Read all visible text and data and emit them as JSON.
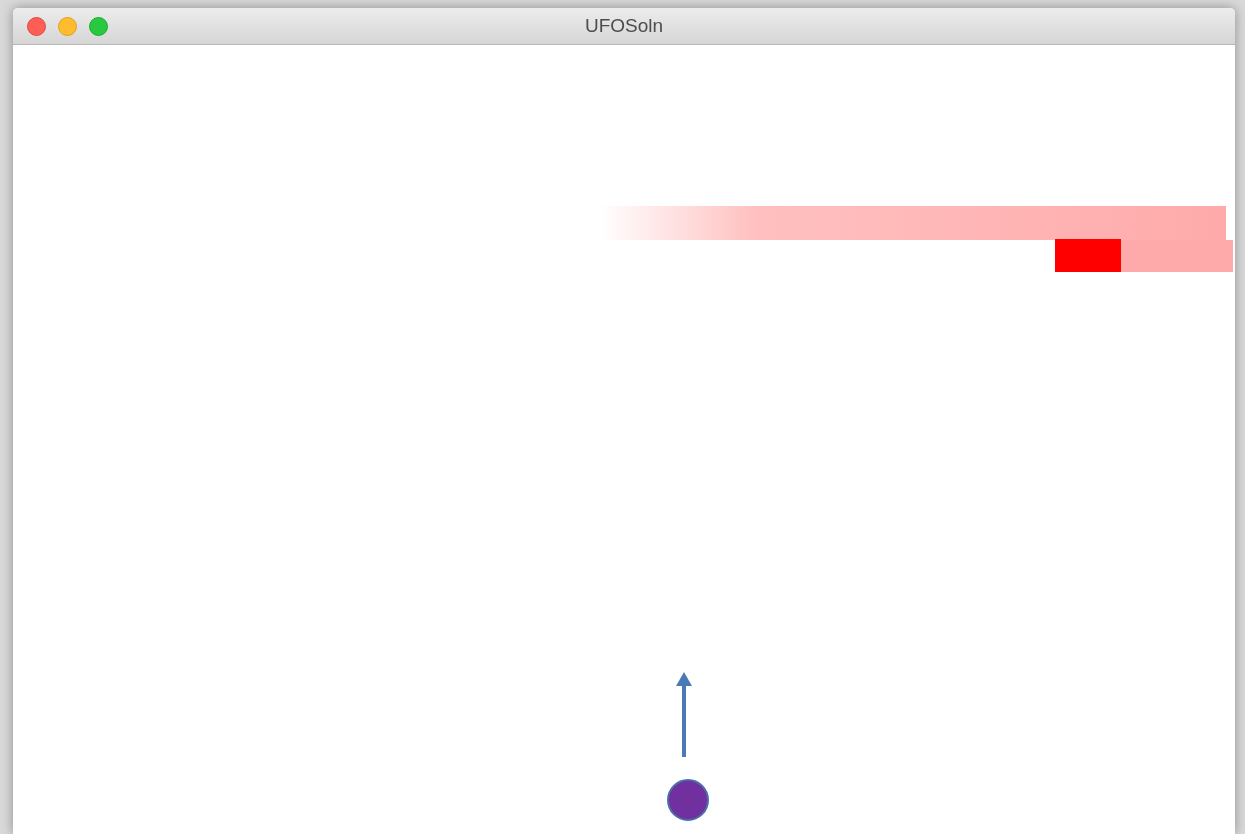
{
  "window": {
    "title": "UFOSoln"
  }
}
